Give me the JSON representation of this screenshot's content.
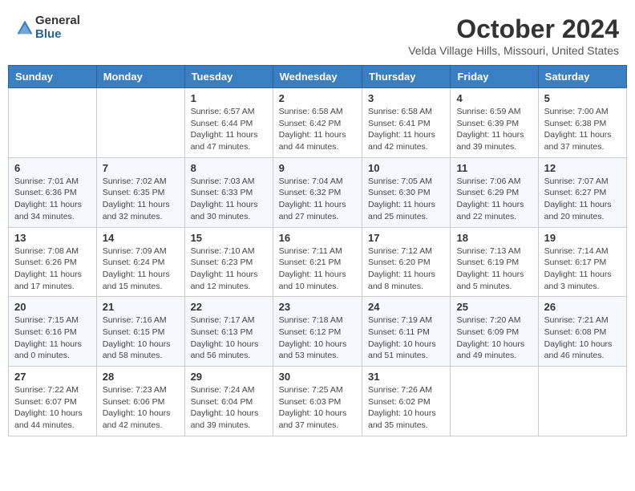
{
  "header": {
    "logo_general": "General",
    "logo_blue": "Blue",
    "month_title": "October 2024",
    "location": "Velda Village Hills, Missouri, United States"
  },
  "days_of_week": [
    "Sunday",
    "Monday",
    "Tuesday",
    "Wednesday",
    "Thursday",
    "Friday",
    "Saturday"
  ],
  "weeks": [
    [
      {
        "day": "",
        "info": ""
      },
      {
        "day": "",
        "info": ""
      },
      {
        "day": "1",
        "info": "Sunrise: 6:57 AM\nSunset: 6:44 PM\nDaylight: 11 hours and 47 minutes."
      },
      {
        "day": "2",
        "info": "Sunrise: 6:58 AM\nSunset: 6:42 PM\nDaylight: 11 hours and 44 minutes."
      },
      {
        "day": "3",
        "info": "Sunrise: 6:58 AM\nSunset: 6:41 PM\nDaylight: 11 hours and 42 minutes."
      },
      {
        "day": "4",
        "info": "Sunrise: 6:59 AM\nSunset: 6:39 PM\nDaylight: 11 hours and 39 minutes."
      },
      {
        "day": "5",
        "info": "Sunrise: 7:00 AM\nSunset: 6:38 PM\nDaylight: 11 hours and 37 minutes."
      }
    ],
    [
      {
        "day": "6",
        "info": "Sunrise: 7:01 AM\nSunset: 6:36 PM\nDaylight: 11 hours and 34 minutes."
      },
      {
        "day": "7",
        "info": "Sunrise: 7:02 AM\nSunset: 6:35 PM\nDaylight: 11 hours and 32 minutes."
      },
      {
        "day": "8",
        "info": "Sunrise: 7:03 AM\nSunset: 6:33 PM\nDaylight: 11 hours and 30 minutes."
      },
      {
        "day": "9",
        "info": "Sunrise: 7:04 AM\nSunset: 6:32 PM\nDaylight: 11 hours and 27 minutes."
      },
      {
        "day": "10",
        "info": "Sunrise: 7:05 AM\nSunset: 6:30 PM\nDaylight: 11 hours and 25 minutes."
      },
      {
        "day": "11",
        "info": "Sunrise: 7:06 AM\nSunset: 6:29 PM\nDaylight: 11 hours and 22 minutes."
      },
      {
        "day": "12",
        "info": "Sunrise: 7:07 AM\nSunset: 6:27 PM\nDaylight: 11 hours and 20 minutes."
      }
    ],
    [
      {
        "day": "13",
        "info": "Sunrise: 7:08 AM\nSunset: 6:26 PM\nDaylight: 11 hours and 17 minutes."
      },
      {
        "day": "14",
        "info": "Sunrise: 7:09 AM\nSunset: 6:24 PM\nDaylight: 11 hours and 15 minutes."
      },
      {
        "day": "15",
        "info": "Sunrise: 7:10 AM\nSunset: 6:23 PM\nDaylight: 11 hours and 12 minutes."
      },
      {
        "day": "16",
        "info": "Sunrise: 7:11 AM\nSunset: 6:21 PM\nDaylight: 11 hours and 10 minutes."
      },
      {
        "day": "17",
        "info": "Sunrise: 7:12 AM\nSunset: 6:20 PM\nDaylight: 11 hours and 8 minutes."
      },
      {
        "day": "18",
        "info": "Sunrise: 7:13 AM\nSunset: 6:19 PM\nDaylight: 11 hours and 5 minutes."
      },
      {
        "day": "19",
        "info": "Sunrise: 7:14 AM\nSunset: 6:17 PM\nDaylight: 11 hours and 3 minutes."
      }
    ],
    [
      {
        "day": "20",
        "info": "Sunrise: 7:15 AM\nSunset: 6:16 PM\nDaylight: 11 hours and 0 minutes."
      },
      {
        "day": "21",
        "info": "Sunrise: 7:16 AM\nSunset: 6:15 PM\nDaylight: 10 hours and 58 minutes."
      },
      {
        "day": "22",
        "info": "Sunrise: 7:17 AM\nSunset: 6:13 PM\nDaylight: 10 hours and 56 minutes."
      },
      {
        "day": "23",
        "info": "Sunrise: 7:18 AM\nSunset: 6:12 PM\nDaylight: 10 hours and 53 minutes."
      },
      {
        "day": "24",
        "info": "Sunrise: 7:19 AM\nSunset: 6:11 PM\nDaylight: 10 hours and 51 minutes."
      },
      {
        "day": "25",
        "info": "Sunrise: 7:20 AM\nSunset: 6:09 PM\nDaylight: 10 hours and 49 minutes."
      },
      {
        "day": "26",
        "info": "Sunrise: 7:21 AM\nSunset: 6:08 PM\nDaylight: 10 hours and 46 minutes."
      }
    ],
    [
      {
        "day": "27",
        "info": "Sunrise: 7:22 AM\nSunset: 6:07 PM\nDaylight: 10 hours and 44 minutes."
      },
      {
        "day": "28",
        "info": "Sunrise: 7:23 AM\nSunset: 6:06 PM\nDaylight: 10 hours and 42 minutes."
      },
      {
        "day": "29",
        "info": "Sunrise: 7:24 AM\nSunset: 6:04 PM\nDaylight: 10 hours and 39 minutes."
      },
      {
        "day": "30",
        "info": "Sunrise: 7:25 AM\nSunset: 6:03 PM\nDaylight: 10 hours and 37 minutes."
      },
      {
        "day": "31",
        "info": "Sunrise: 7:26 AM\nSunset: 6:02 PM\nDaylight: 10 hours and 35 minutes."
      },
      {
        "day": "",
        "info": ""
      },
      {
        "day": "",
        "info": ""
      }
    ]
  ]
}
